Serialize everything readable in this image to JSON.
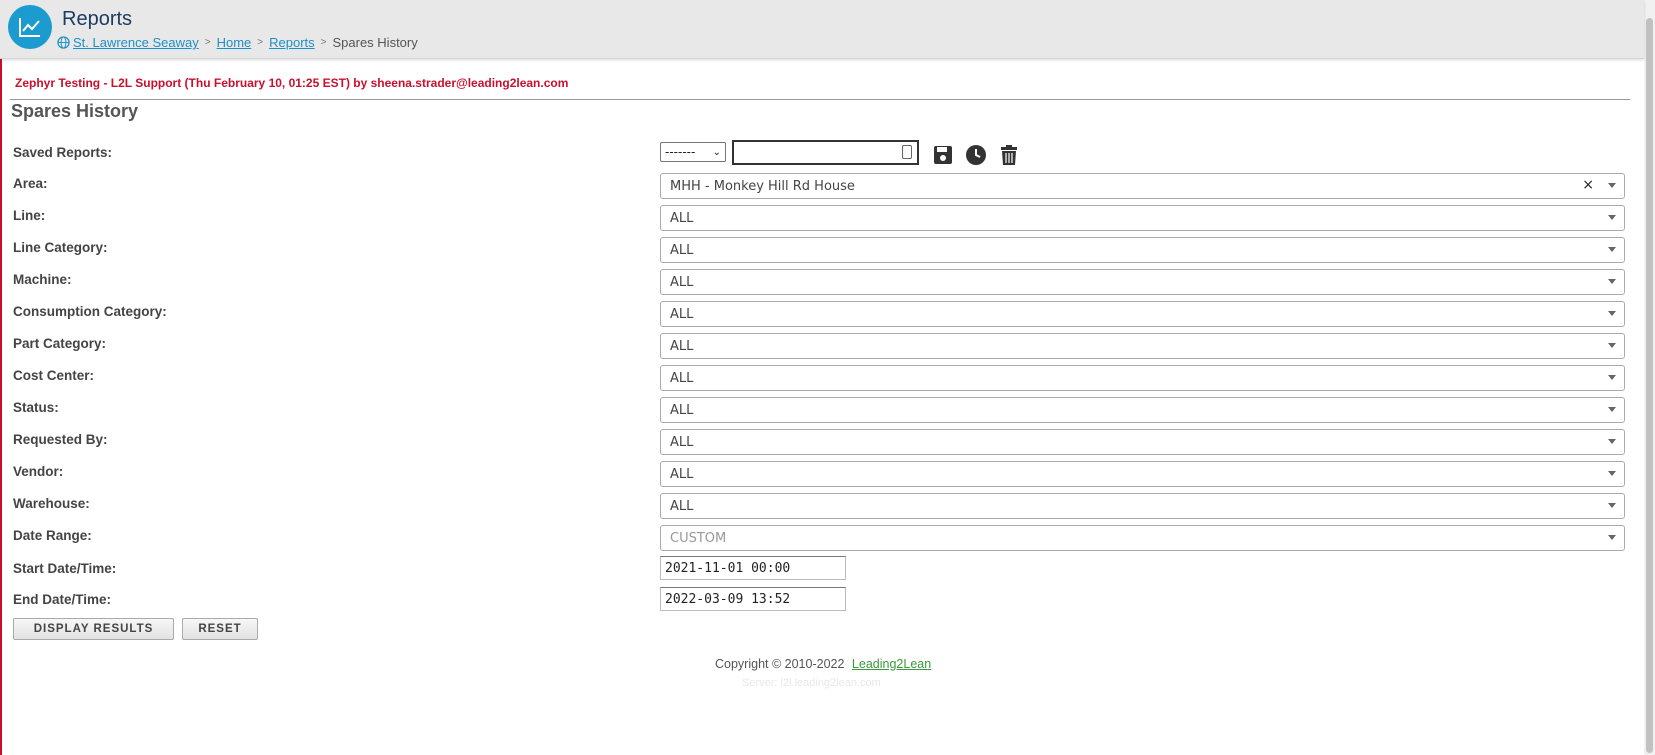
{
  "header": {
    "title": "Reports",
    "breadcrumb": [
      "St. Lawrence Seaway",
      "Home",
      "Reports",
      "Spares History"
    ],
    "separator": ">"
  },
  "banner": "Zephyr Testing - L2L Support (Thu February 10, 01:25 EST) by sheena.strader@leading2lean.com",
  "page_title": "Spares History",
  "saved_reports": {
    "label": "Saved Reports:",
    "select_value": "-------",
    "input_value": "",
    "icons": [
      "save-icon",
      "clock-icon",
      "trash-icon"
    ]
  },
  "filters": [
    {
      "label": "Area:",
      "value": "MHH - Monkey Hill Rd House",
      "clearable": true
    },
    {
      "label": "Line:",
      "value": "ALL"
    },
    {
      "label": "Line Category:",
      "value": "ALL"
    },
    {
      "label": "Machine:",
      "value": "ALL"
    },
    {
      "label": "Consumption Category:",
      "value": "ALL"
    },
    {
      "label": "Part Category:",
      "value": "ALL"
    },
    {
      "label": "Cost Center:",
      "value": "ALL"
    },
    {
      "label": "Status:",
      "value": "ALL"
    },
    {
      "label": "Requested By:",
      "value": "ALL"
    },
    {
      "label": "Vendor:",
      "value": "ALL"
    },
    {
      "label": "Warehouse:",
      "value": "ALL"
    },
    {
      "label": "Date Range:",
      "value": "CUSTOM",
      "disabled": true
    }
  ],
  "clear_symbol": "×",
  "start": {
    "label": "Start Date/Time:",
    "value": "2021-11-01 00:00"
  },
  "end": {
    "label": "End Date/Time:",
    "value": "2022-03-09 13:52"
  },
  "buttons": {
    "display": "DISPLAY RESULTS",
    "reset": "RESET"
  },
  "footer": {
    "copyright": "Copyright © 2010-2022",
    "link": "Leading2Lean",
    "server": "Server: l2l.leading2lean.com"
  },
  "colors": {
    "accent": "#1c9bd1",
    "banner": "#c8102e",
    "link": "#1c8fc7",
    "footer_link": "#3a9a3a"
  }
}
